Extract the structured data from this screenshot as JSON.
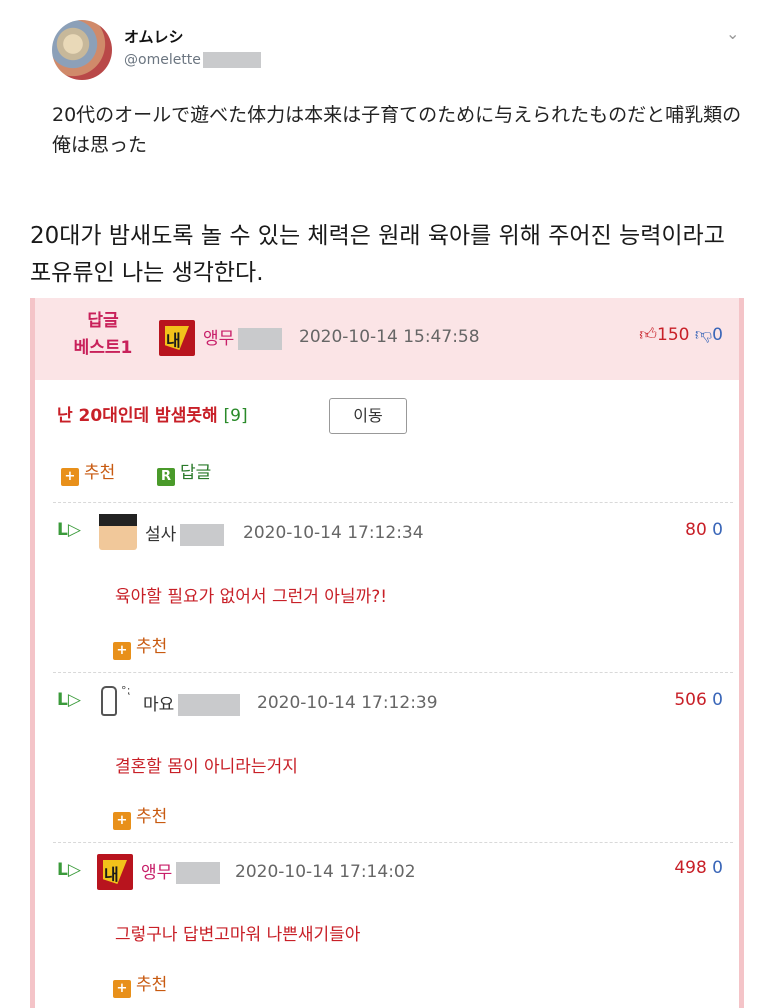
{
  "tweet": {
    "name": "オムレシ",
    "handle": "@omelette",
    "text": "20代のオールで遊べた体力は本来は子育てのために与えられたものだと哺乳類の俺は思った"
  },
  "translation": "20대가 밤새도록 놀 수 있는 체력은 원래 육아를 위해 주어진 능력이라고 포유류인 나는 생각한다.",
  "best": {
    "badge_line1": "답글",
    "badge_line2": "베스트1",
    "nick": "앵무",
    "date": "2020-10-14 15:47:58",
    "up_icon": "thumbs-up-icon",
    "up": "150",
    "down_icon": "thumbs-down-icon",
    "down": "0",
    "title": "난 20대인데 밤샘못해",
    "reply_count": "[9]",
    "move_label": "이동",
    "recommend_label": "추천",
    "reply_label": "답글"
  },
  "replies": [
    {
      "nick": "설사",
      "date": "2020-10-14 17:12:34",
      "up": "80",
      "down": "0",
      "text": "육아할 필요가 없어서 그런거 아닐까?!",
      "recommend_label": "추천"
    },
    {
      "nick": "마요",
      "date": "2020-10-14 17:12:39",
      "up": "506",
      "down": "0",
      "text": "결혼할 몸이 아니라는거지",
      "recommend_label": "추천"
    },
    {
      "nick": "앵무",
      "date": "2020-10-14 17:14:02",
      "up": "498",
      "down": "0",
      "text": "그렇구나 답변고마워 나쁜새기들아",
      "recommend_label": "추천"
    }
  ],
  "icons": {
    "reply_arrow": "reply-arrow-icon",
    "chevron": "chevron-down-icon"
  },
  "colors": {
    "accent_pink": "#c8205a",
    "comment_red": "#c82028",
    "best_bg": "#fbe4e6"
  }
}
